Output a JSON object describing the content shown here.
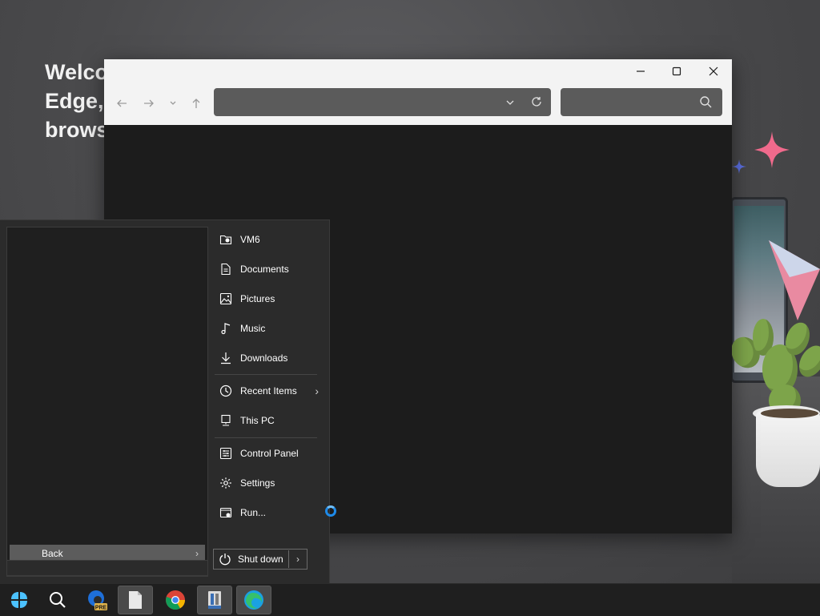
{
  "background": {
    "welcome_text": "Welco\nEdge,\nbrows"
  },
  "explorer": {
    "window_controls": [
      "minimize",
      "maximize",
      "close"
    ],
    "nav": [
      "back-arrow",
      "forward-arrow",
      "recent-dropdown",
      "up-arrow"
    ],
    "address_value": "",
    "search_value": ""
  },
  "start_menu": {
    "back_label": "Back",
    "items": [
      {
        "label": "VM6",
        "icon": "user-folder-icon"
      },
      {
        "label": "Documents",
        "icon": "document-icon"
      },
      {
        "label": "Pictures",
        "icon": "picture-icon"
      },
      {
        "label": "Music",
        "icon": "music-note-icon"
      },
      {
        "label": "Downloads",
        "icon": "download-icon"
      },
      {
        "label": "Recent Items",
        "icon": "clock-icon",
        "submenu": true
      },
      {
        "label": "This PC",
        "icon": "computer-icon"
      },
      {
        "label": "Control Panel",
        "icon": "control-panel-icon"
      },
      {
        "label": "Settings",
        "icon": "gear-icon"
      },
      {
        "label": "Run...",
        "icon": "run-icon"
      }
    ],
    "shutdown_label": "Shut down"
  },
  "taskbar": {
    "apps": [
      "start-button",
      "search",
      "edge-preview",
      "file-explorer",
      "chrome",
      "app-installer",
      "edge"
    ],
    "edge_preview_badge": "PRE",
    "active": [
      "file-explorer",
      "app-installer",
      "edge"
    ]
  },
  "colors": {
    "accent": "#1e8ae8",
    "menu_bg": "#2b2b2b",
    "titlebar_bg": "#f3f3f3"
  }
}
